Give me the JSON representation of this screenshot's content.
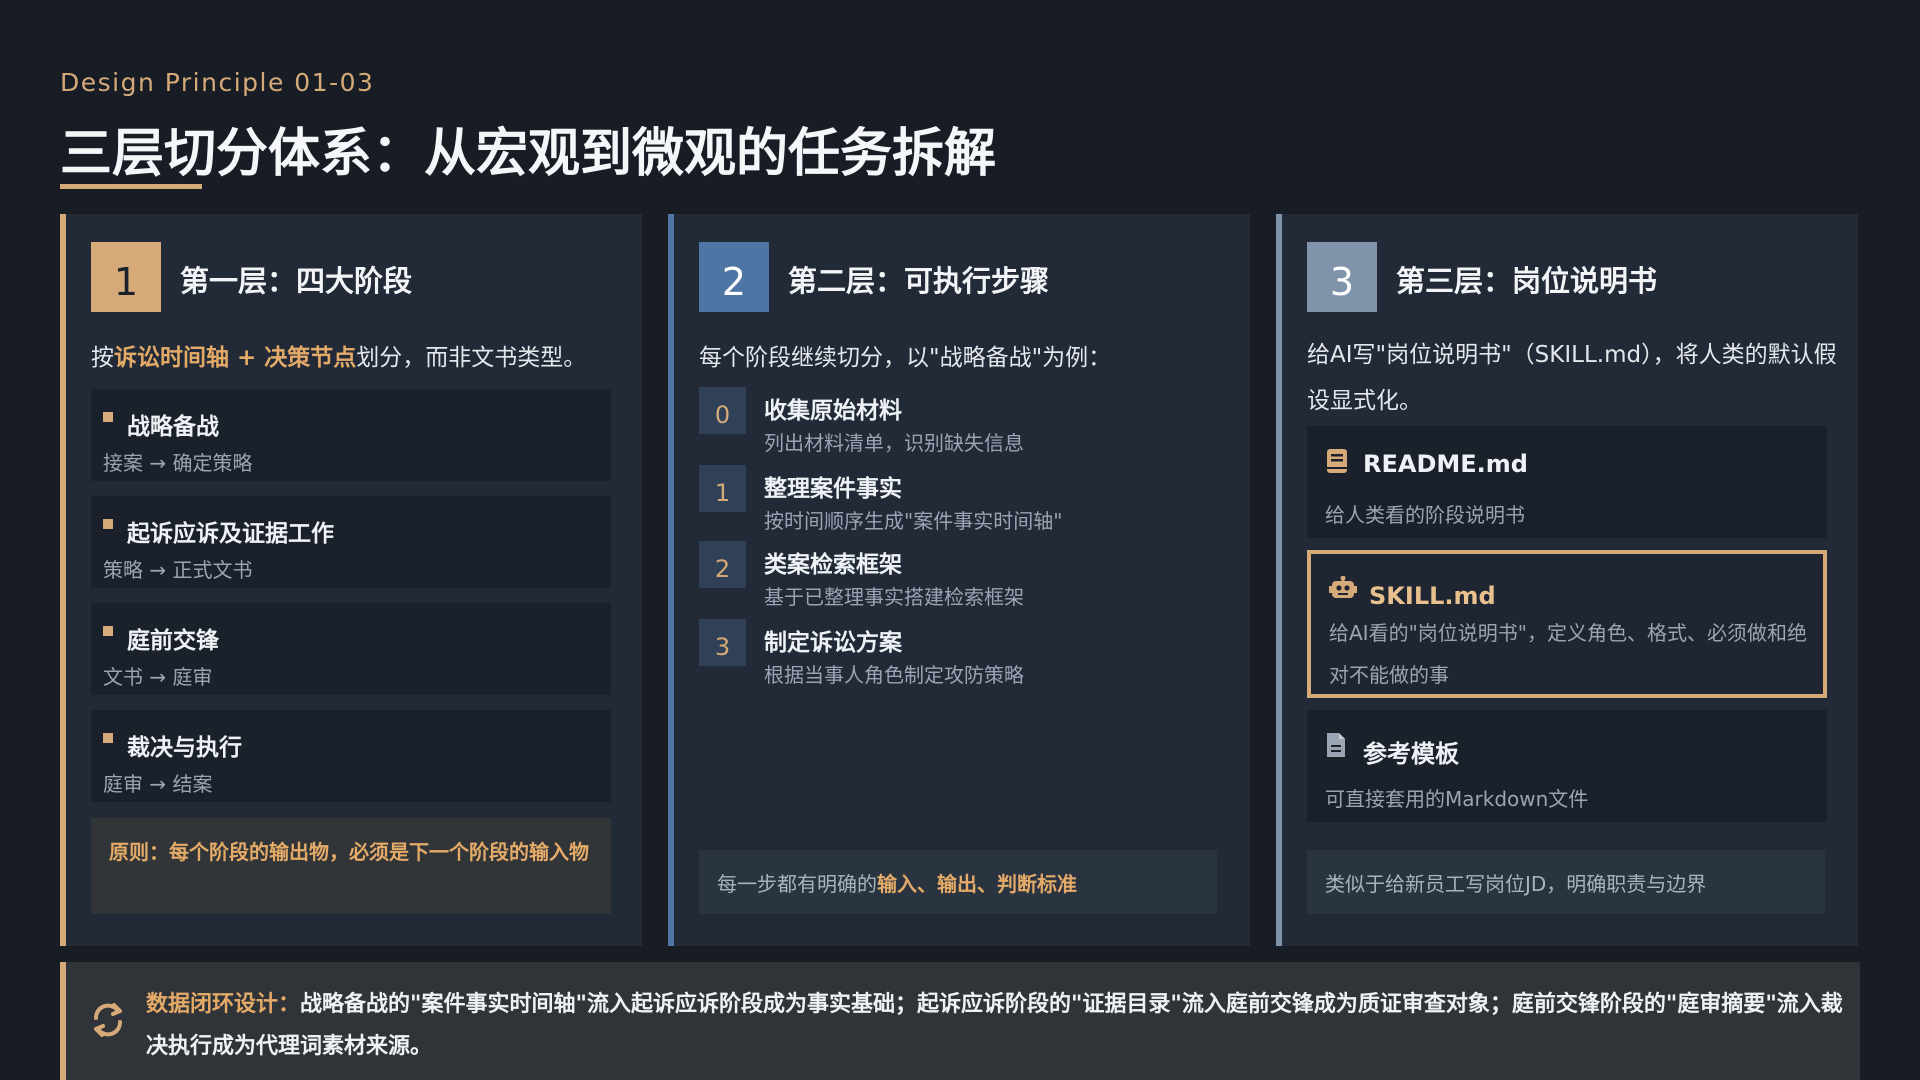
{
  "header": {
    "eyebrow": "Design Principle 01-03",
    "title": "三层切分体系：从宏观到微观的任务拆解"
  },
  "col1": {
    "num": "1",
    "title": "第一层：四大阶段",
    "intro_pre": "按",
    "intro_hl": "诉讼时间轴 + 决策节点",
    "intro_post": "划分，而非文书类型。",
    "stages": [
      {
        "name": "战略备战",
        "sub": "接案 → 确定策略"
      },
      {
        "name": "起诉应诉及证据工作",
        "sub": "策略 → 正式文书"
      },
      {
        "name": "庭前交锋",
        "sub": "文书 → 庭审"
      },
      {
        "name": "裁决与执行",
        "sub": "庭审 → 结案"
      }
    ],
    "principle": "原则：每个阶段的输出物，必须是下一个阶段的输入物"
  },
  "col2": {
    "num": "2",
    "title": "第二层：可执行步骤",
    "intro": "每个阶段继续切分，以\"战略备战\"为例：",
    "steps": [
      {
        "num": "0",
        "title": "收集原始材料",
        "desc": "列出材料清单，识别缺失信息"
      },
      {
        "num": "1",
        "title": "整理案件事实",
        "desc": "按时间顺序生成\"案件事实时间轴\""
      },
      {
        "num": "2",
        "title": "类案检索框架",
        "desc": "基于已整理事实搭建检索框架"
      },
      {
        "num": "3",
        "title": "制定诉讼方案",
        "desc": "根据当事人角色制定攻防策略"
      }
    ],
    "footnote_pre": "每一步都有明确的",
    "footnote_hl": "输入、输出、判断标准"
  },
  "col3": {
    "num": "3",
    "title": "第三层：岗位说明书",
    "intro": "给AI写\"岗位说明书\"（SKILL.md），将人类的默认假设显式化。",
    "files": [
      {
        "name": "README.md",
        "desc": "给人类看的阶段说明书",
        "icon": "book-icon"
      },
      {
        "name": "SKILL.md",
        "desc": "给AI看的\"岗位说明书\"，定义角色、格式、必须做和绝对不能做的事",
        "icon": "robot-icon"
      },
      {
        "name": "参考模板",
        "desc": "可直接套用的Markdown文件",
        "icon": "document-icon"
      }
    ],
    "footnote": "类似于给新员工写岗位JD，明确职责与边界"
  },
  "loop": {
    "icon": "refresh-icon",
    "head": "数据闭环设计：",
    "text": "战略备战的\"案件事实时间轴\"流入起诉应诉阶段成为事实基础；起诉应诉阶段的\"证据目录\"流入庭前交锋成为质证审查对象；庭前交锋阶段的\"庭审摘要\"流入裁决执行成为代理词素材来源。"
  },
  "colors": {
    "accent_gold": "#d5aa78",
    "accent_blue": "#4f75a4",
    "accent_steel": "#7f93ab",
    "background": "#171c25",
    "panel": "#212a36"
  }
}
